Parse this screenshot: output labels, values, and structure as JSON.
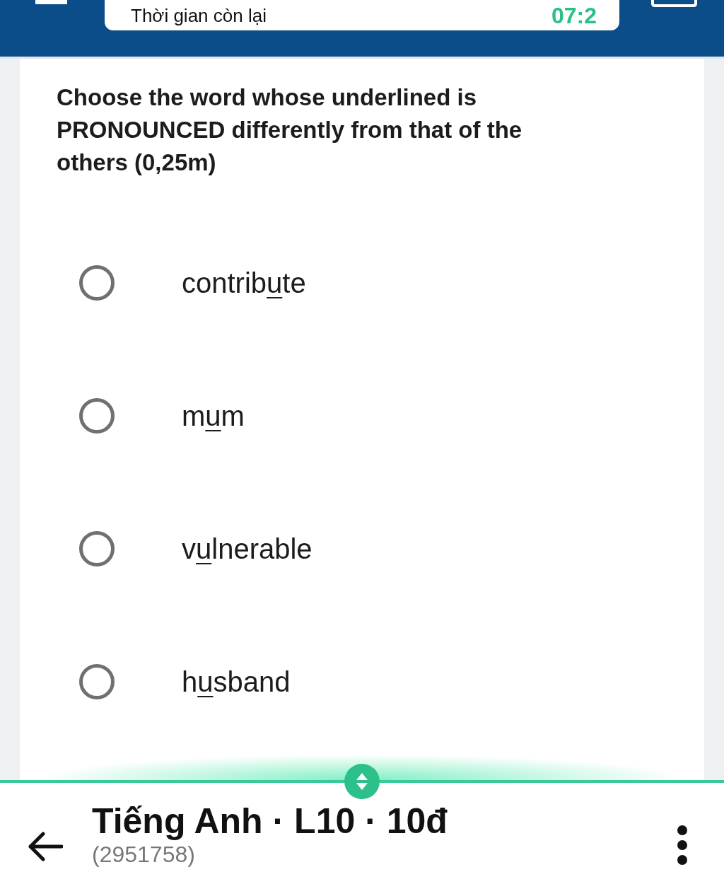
{
  "header": {
    "label": "Thời gian còn lại",
    "timer": "07:2"
  },
  "question": {
    "text": "Choose the word whose underlined is PRONOUNCED differently from that of the others (0,25m)",
    "options": [
      {
        "selected": false,
        "before": "contrib",
        "underlined": "u",
        "after": "te"
      },
      {
        "selected": false,
        "before": "m",
        "underlined": "u",
        "after": "m"
      },
      {
        "selected": false,
        "before": "v",
        "underlined": "u",
        "after": "lnerable"
      },
      {
        "selected": false,
        "before": "h",
        "underlined": "u",
        "after": "sband"
      }
    ]
  },
  "footer": {
    "title": "Tiếng Anh · L10 · 10đ",
    "subtitle": "(2951758)"
  }
}
